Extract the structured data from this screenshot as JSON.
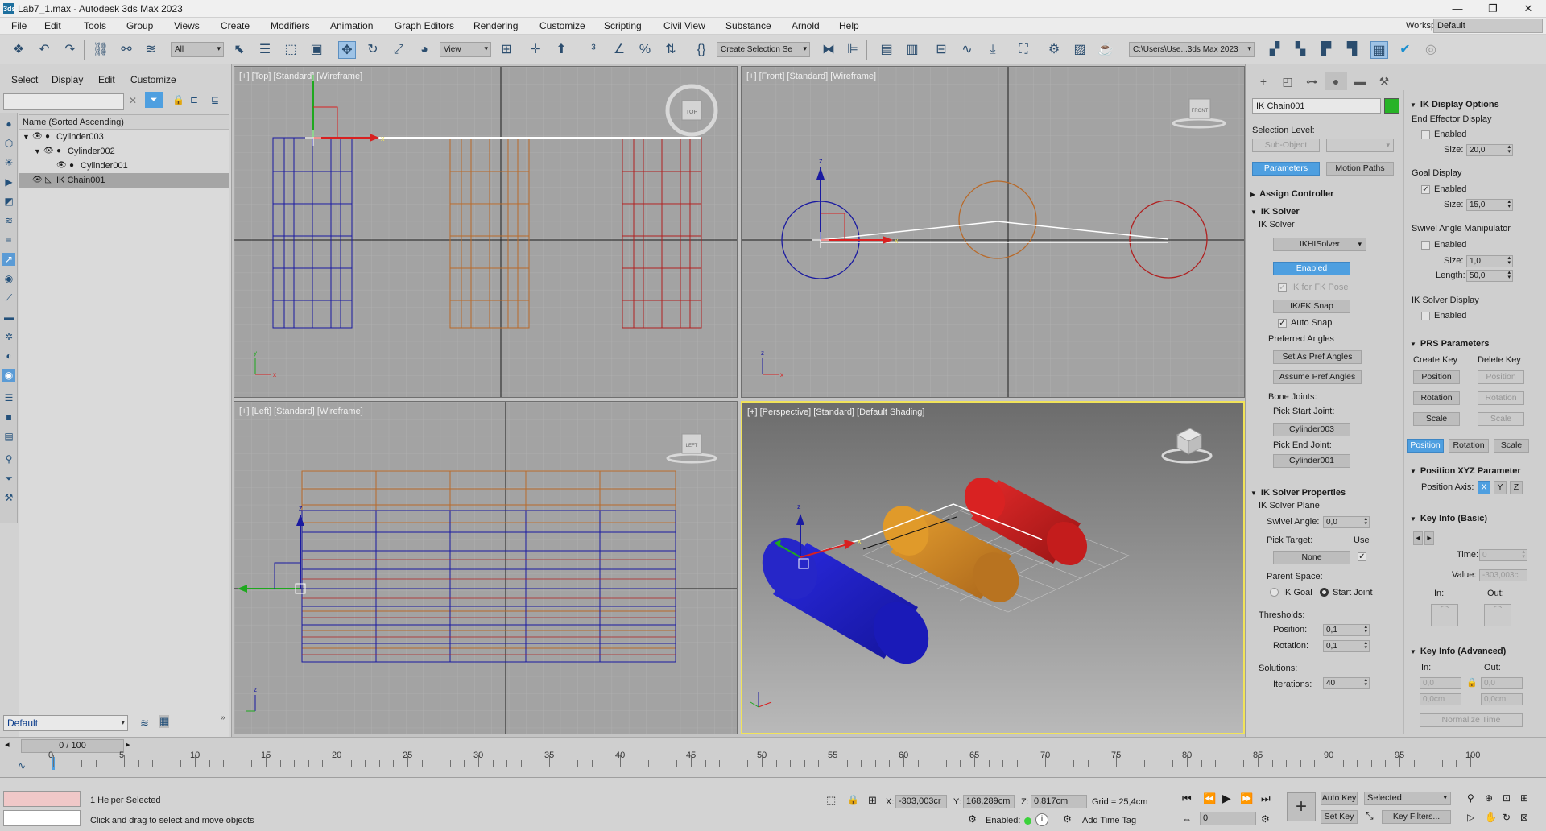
{
  "titlebar": {
    "title": "Lab7_1.max - Autodesk 3ds Max 2023",
    "app_icon": "3ds",
    "min": "—",
    "max": "❐",
    "close": "✕"
  },
  "menu": {
    "items": [
      "File",
      "Edit",
      "Tools",
      "Group",
      "Views",
      "Create",
      "Modifiers",
      "Animation",
      "Graph Editors",
      "Rendering",
      "Customize",
      "Scripting",
      "Civil View",
      "Substance",
      "Arnold",
      "Help"
    ],
    "workspaces_label": "Workspaces:",
    "workspace_value": "Default"
  },
  "toolbar": {
    "filter_value": "All",
    "refcoord_value": "View",
    "selection_set_value": "Create Selection Se",
    "project_path": "C:\\Users\\Use...3ds Max 2023"
  },
  "scene_explorer": {
    "menu": [
      "Select",
      "Display",
      "Edit",
      "Customize"
    ],
    "column_header": "Name (Sorted Ascending)",
    "rows": [
      {
        "label": "Cylinder003"
      },
      {
        "label": "Cylinder002"
      },
      {
        "label": "Cylinder001"
      },
      {
        "label": "IK Chain001"
      }
    ],
    "layer_value": "Default"
  },
  "viewports": {
    "top": {
      "label": "[+] [Top] [Standard] [Wireframe]",
      "cube_label": "TOP"
    },
    "front": {
      "label": "[+] [Front] [Standard] [Wireframe]",
      "cube_label": "FRONT"
    },
    "left": {
      "label": "[+] [Left] [Standard] [Wireframe]",
      "cube_label": "LEFT"
    },
    "perspective": {
      "label": "[+] [Perspective] [Standard] [Default Shading]"
    }
  },
  "command_panel": {
    "object_name": "IK Chain001",
    "object_color": "#27b327",
    "selection_level_label": "Selection Level:",
    "sub_object": "Sub-Object",
    "parameters_tab": "Parameters",
    "motion_paths_tab": "Motion Paths",
    "assign_controller": "Assign Controller",
    "ik_solver": {
      "header": "IK Solver",
      "sub": "IK Solver",
      "solver_value": "IKHISolver",
      "enabled_btn": "Enabled",
      "ik_for_fk_pose": "IK for FK Pose",
      "ik_fk_snap": "IK/FK Snap",
      "auto_snap": "Auto Snap",
      "preferred_angles": "Preferred Angles",
      "set_as_pref": "Set As Pref Angles",
      "assume_pref": "Assume Pref Angles",
      "bone_joints": "Bone Joints:",
      "pick_start": "Pick Start Joint:",
      "start_joint": "Cylinder003",
      "pick_end": "Pick End Joint:",
      "end_joint": "Cylinder001"
    },
    "ik_solver_props": {
      "header": "IK Solver Properties",
      "plane": "IK Solver Plane",
      "swivel_label": "Swivel Angle:",
      "swivel_value": "0,0",
      "pick_target": "Pick Target:",
      "use": "Use",
      "none_btn": "None",
      "parent_space": "Parent Space:",
      "ik_goal": "IK Goal",
      "start_joint": "Start Joint",
      "thresholds": "Thresholds:",
      "position_label": "Position:",
      "position_value": "0,1",
      "rotation_label": "Rotation:",
      "rotation_value": "0,1",
      "solutions": "Solutions:",
      "iterations_label": "Iterations:",
      "iterations_value": "40"
    },
    "ik_display": {
      "header": "IK Display Options",
      "end_effector": "End Effector Display",
      "enabled": "Enabled",
      "size_label": "Size:",
      "ee_size": "20,0",
      "goal_display": "Goal Display",
      "goal_size": "15,0",
      "swivel_manip": "Swivel Angle Manipulator",
      "swivel_size": "1,0",
      "length_label": "Length:",
      "swivel_length": "50,0",
      "solver_display": "IK Solver Display"
    },
    "prs": {
      "header": "PRS Parameters",
      "create_key": "Create Key",
      "delete_key": "Delete Key",
      "position": "Position",
      "rotation": "Rotation",
      "scale": "Scale"
    },
    "pos_xyz": {
      "header": "Position XYZ Parameter",
      "axis_label": "Position Axis:",
      "x": "X",
      "y": "Y",
      "z": "Z"
    },
    "key_info_basic": {
      "header": "Key Info (Basic)",
      "time_label": "Time:",
      "time_value": "0",
      "value_label": "Value:",
      "value_value": "-303,003c",
      "in_label": "In:",
      "out_label": "Out:"
    },
    "key_info_adv": {
      "header": "Key Info (Advanced)",
      "in_label": "In:",
      "out_label": "Out:",
      "in1": "0,0",
      "out1": "0,0",
      "in2": "0,0cm",
      "out2": "0,0cm",
      "normalize": "Normalize Time"
    }
  },
  "timeline": {
    "frame_counter": "0 / 100",
    "ticks": [
      "0",
      "5",
      "10",
      "15",
      "20",
      "25",
      "30",
      "35",
      "40",
      "45",
      "50",
      "55",
      "60",
      "65",
      "70",
      "75",
      "80",
      "85",
      "90",
      "95",
      "100"
    ]
  },
  "status": {
    "selected_text": "1 Helper Selected",
    "prompt": "Click and drag to select and move objects",
    "x_label": "X:",
    "x_value": "-303,003cr",
    "y_label": "Y:",
    "y_value": "168,289cm",
    "z_label": "Z:",
    "z_value": "0,817cm",
    "grid": "Grid = 25,4cm",
    "enabled_label": "Enabled:",
    "add_time_tag": "Add Time Tag",
    "auto_key": "Auto Key",
    "set_key": "Set Key",
    "selected_value": "Selected",
    "key_filters": "Key Filters...",
    "frame_value": "0"
  }
}
